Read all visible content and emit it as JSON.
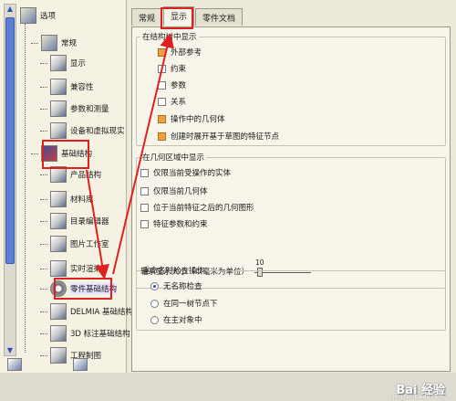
{
  "tree": {
    "root_label": "选项",
    "items": [
      {
        "label": "常规",
        "icon": "settings-folder-icon"
      },
      {
        "label": "显示",
        "icon": "display-monitor-icon"
      },
      {
        "label": "兼容性",
        "icon": "compatibility-icon"
      },
      {
        "label": "参数和测量",
        "icon": "parameters-measure-icon"
      },
      {
        "label": "设备和虚拟现实",
        "icon": "devices-vr-icon"
      },
      {
        "label": "基础结构",
        "icon": "infrastructure-folder-icon"
      },
      {
        "label": "产品结构",
        "icon": "product-structure-icon"
      },
      {
        "label": "材料库",
        "icon": "material-library-icon"
      },
      {
        "label": "目录编辑器",
        "icon": "catalog-editor-icon"
      },
      {
        "label": "图片工作室",
        "icon": "photo-studio-icon"
      },
      {
        "label": "实时渲染",
        "icon": "realtime-render-icon"
      },
      {
        "label": "零件基础结构",
        "icon": "part-infrastructure-gear-icon"
      },
      {
        "label": "DELMIA 基础结构",
        "icon": "delmia-icon"
      },
      {
        "label": "3D 标注基础结构",
        "icon": "annotation-3d-icon"
      },
      {
        "label": "工程制图",
        "icon": "drafting-icon"
      }
    ]
  },
  "tabs": [
    "常规",
    "显示",
    "零件文档"
  ],
  "active_tab": "显示",
  "sections": {
    "spec_tree": {
      "title": "在结构树中显示",
      "options": [
        {
          "label": "外部参考",
          "checked": true
        },
        {
          "label": "约束",
          "checked": false
        },
        {
          "label": "参数",
          "checked": false
        },
        {
          "label": "关系",
          "checked": false
        },
        {
          "label": "操作中的几何体",
          "checked": true
        },
        {
          "label": "创建时展开基于草图的特征节点",
          "checked": true
        }
      ]
    },
    "geometry_area": {
      "title": "在几何区域中显示",
      "options": [
        {
          "label": "仅限当前受操作的实体",
          "checked": false
        },
        {
          "label": "仅限当前几何体",
          "checked": false
        },
        {
          "label": "位于当前特征之后的几何图形",
          "checked": false
        },
        {
          "label": "特征参数和约束",
          "checked": false
        }
      ],
      "slider": {
        "label": "轴系显示大小（以毫米为单位）",
        "value": "10",
        "fraction": 0.05
      }
    },
    "rename_check": {
      "title": "重命名时检查操作",
      "options": [
        {
          "label": "无名称检查",
          "selected": true
        },
        {
          "label": "在同一树节点下",
          "selected": false
        },
        {
          "label": "在主对象中",
          "selected": false
        }
      ]
    }
  },
  "watermark": {
    "text": "Bai 经验",
    "sub": "jingyan.baidu.com"
  },
  "colors": {
    "highlight": "#e02020",
    "checked": "#f0a040",
    "scroll_thumb": "#5c7fd6"
  }
}
